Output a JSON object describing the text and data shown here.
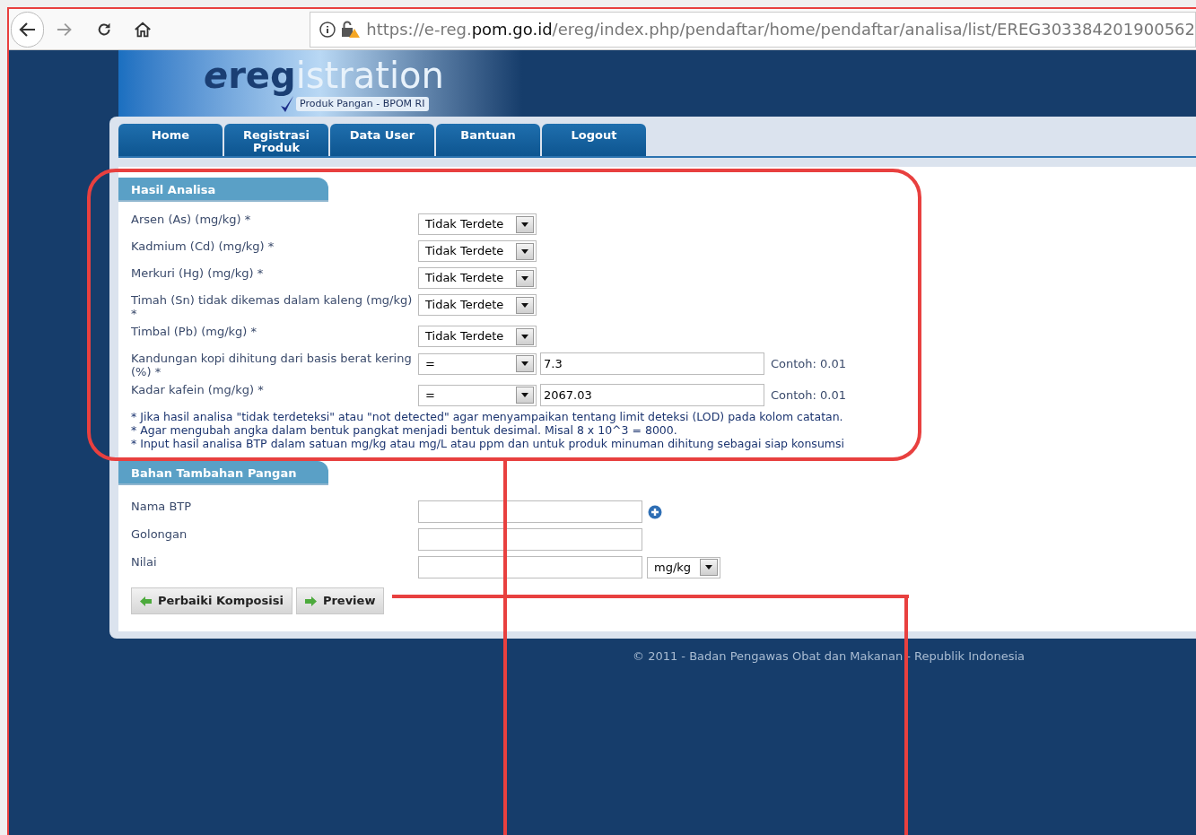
{
  "browser": {
    "url": {
      "prefix": "https://e-reg.",
      "domain": "pom.go.id",
      "path": "/ereg/index.php/pendaftar/home/pendaftar/analisa/list/EREG303384201900562"
    }
  },
  "header": {
    "logo_e": "e",
    "logo_reg": "reg",
    "logo_rest": "istration",
    "tagline": "Produk Pangan - BPOM RI"
  },
  "nav": [
    {
      "label": "Home"
    },
    {
      "label": "Registrasi Produk"
    },
    {
      "label": "Data User"
    },
    {
      "label": "Bantuan"
    },
    {
      "label": "Logout"
    }
  ],
  "sections": [
    {
      "title": "Hasil Analisa",
      "rows": [
        {
          "kind": "select",
          "label": "Arsen (As) (mg/kg) *",
          "value": "Tidak Terdete"
        },
        {
          "kind": "select",
          "label": "Kadmium (Cd) (mg/kg) *",
          "value": "Tidak Terdete"
        },
        {
          "kind": "select",
          "label": "Merkuri (Hg) (mg/kg) *",
          "value": "Tidak Terdete"
        },
        {
          "kind": "select",
          "label": "Timah (Sn) tidak dikemas dalam kaleng (mg/kg) *",
          "value": "Tidak Terdete"
        },
        {
          "kind": "select",
          "label": "Timbal (Pb) (mg/kg) *",
          "value": "Tidak Terdete"
        },
        {
          "kind": "operator",
          "label": "Kandungan kopi dihitung dari basis berat kering (%) *",
          "operator": "=",
          "value": "7.3",
          "hint": "Contoh: 0.01"
        },
        {
          "kind": "operator",
          "label": "Kadar kafein (mg/kg) *",
          "operator": "=",
          "value": "2067.03",
          "hint": "Contoh: 0.01"
        }
      ],
      "notes": [
        "* Jika hasil analisa \"tidak terdeteksi\" atau \"not detected\" agar menyampaikan tentang limit deteksi (LOD) pada kolom catatan.",
        "* Agar mengubah angka dalam bentuk pangkat menjadi bentuk desimal. Misal 8 x 10^3 = 8000.",
        "* Input hasil analisa BTP dalam satuan mg/kg atau mg/L atau ppm dan untuk produk minuman dihitung sebagai siap konsumsi"
      ]
    },
    {
      "title": "Bahan Tambahan Pangan",
      "rows": [
        {
          "kind": "text_add",
          "label": "Nama BTP"
        },
        {
          "kind": "text",
          "label": "Golongan"
        },
        {
          "kind": "text_unit",
          "label": "Nilai",
          "unit": "mg/kg"
        }
      ]
    }
  ],
  "buttons": [
    {
      "kind": "back",
      "label": "Perbaiki Komposisi"
    },
    {
      "kind": "next",
      "label": "Preview"
    }
  ],
  "footer": "© 2011 - Badan Pengawas Obat dan Makanan - Republik Indonesia"
}
